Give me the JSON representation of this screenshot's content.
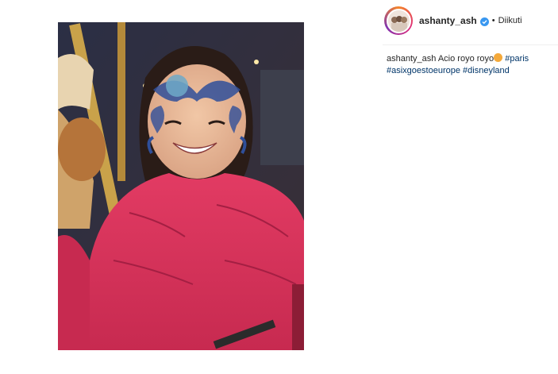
{
  "post": {
    "username": "ashanty_ash",
    "follow_status": "Diikuti",
    "separator": "•",
    "caption_user": "ashanty_ash",
    "caption_text": "Acio royo royo",
    "hashtags": [
      "#paris",
      "#asixgoestoeurope",
      "#disneyland"
    ]
  },
  "colors": {
    "verified": "#3897f0",
    "hashtag": "#003569",
    "jacket": "#d8325a"
  },
  "icons": {
    "verified": "verified-badge-icon",
    "emoji": "heart-eyes-emoji-icon"
  }
}
